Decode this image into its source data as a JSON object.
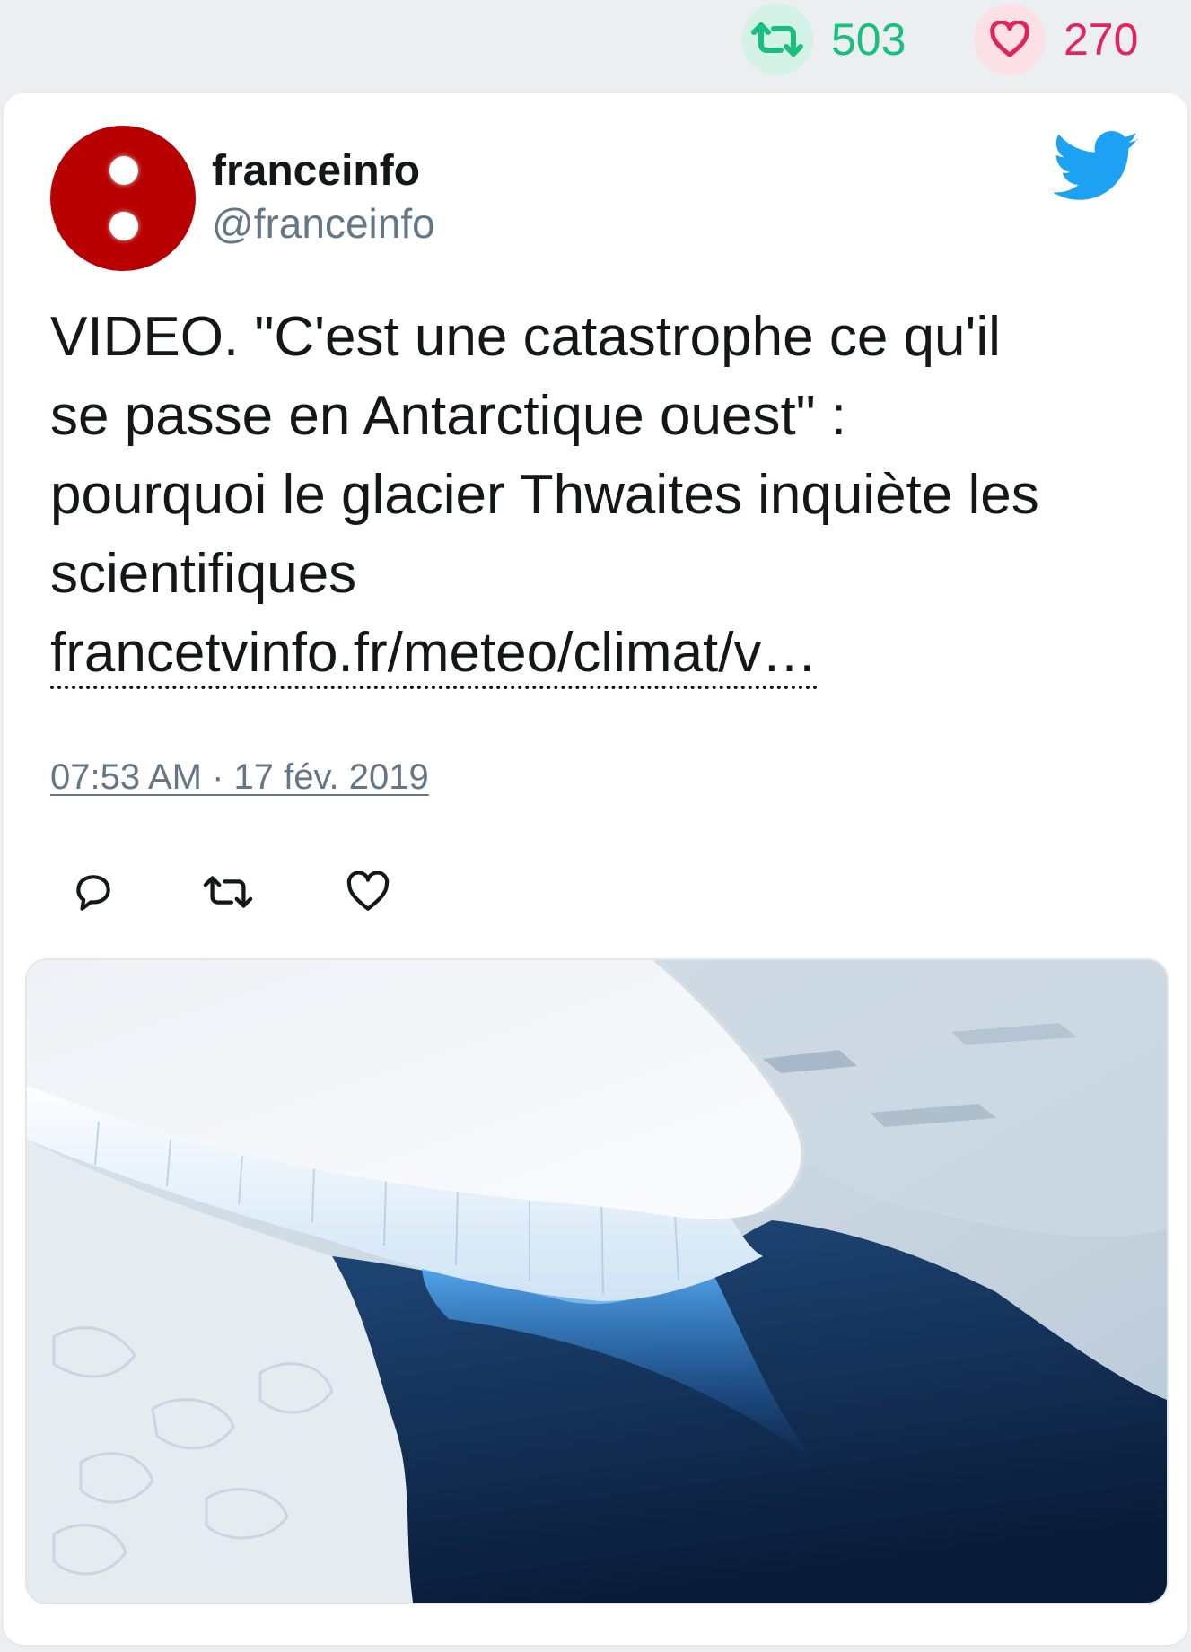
{
  "stats": {
    "retweets": "503",
    "likes": "270",
    "retweet_color": "#19bf7c",
    "like_color": "#e0245e"
  },
  "tweet": {
    "author_name": "franceinfo",
    "author_handle": "@franceinfo",
    "text_lines": [
      "VIDEO. \"C'est une catastrophe ce qu'il",
      "se passe en Antarctique ouest\" :",
      "pourquoi le glacier Thwaites inquiète les",
      "scientifiques"
    ],
    "link_text": "francetvinfo.fr/meteo/climat/v…",
    "timestamp": "07:53 AM · 17 fév. 2019",
    "avatar_color": "#b80000",
    "brand_color": "#1da1f2"
  },
  "icons": {
    "stats_retweet": "retweet-icon",
    "stats_like": "heart-icon",
    "brand": "twitter-bird-icon",
    "reply": "reply-icon",
    "retweet": "retweet-icon",
    "like": "heart-icon"
  },
  "media": {
    "image_subject": "glacier-photo"
  }
}
